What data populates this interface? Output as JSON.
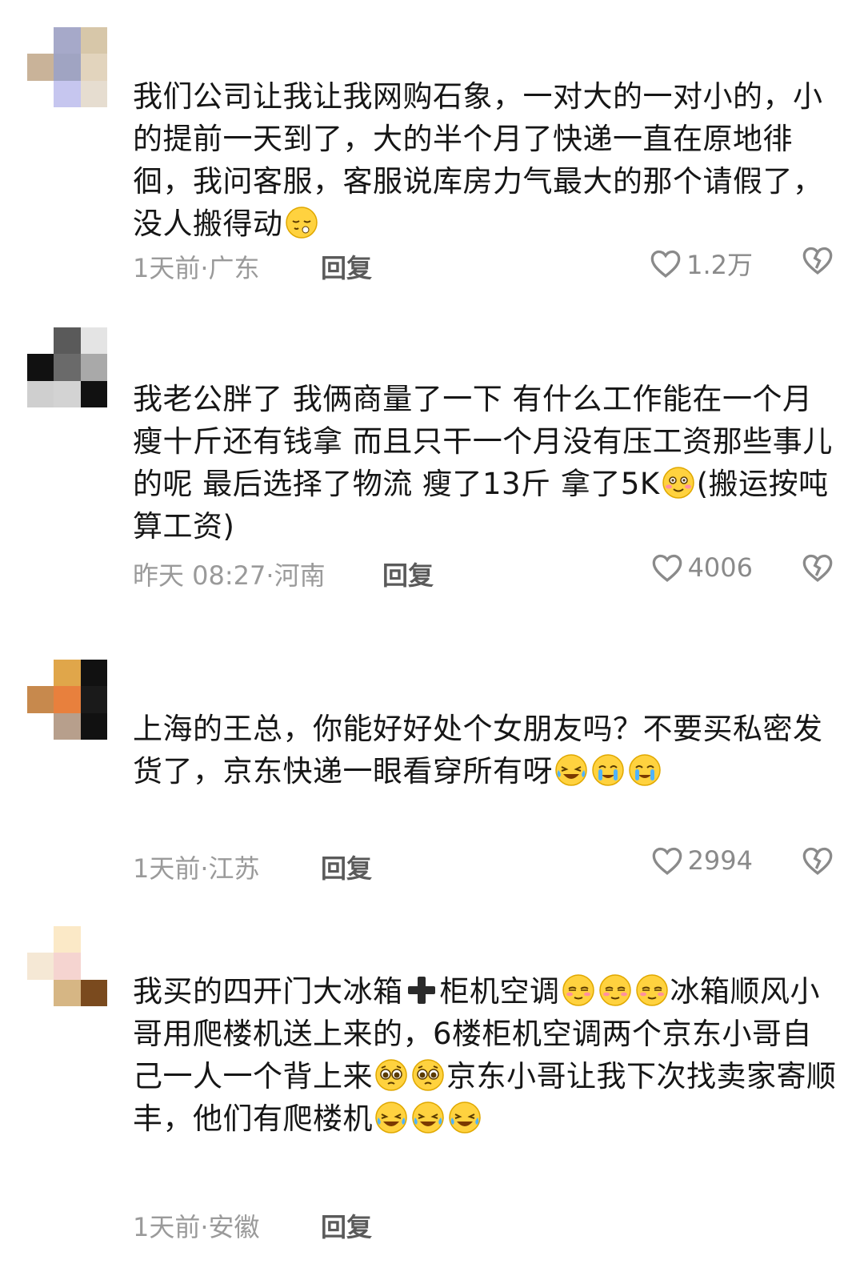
{
  "comments": [
    {
      "avatar_colors": [
        "#ffffff",
        "#a6a9c9",
        "#d7c7a9",
        "#c9b399",
        "#a0a4c2",
        "#e2d4bd",
        "#ffffff",
        "#c6c6ef",
        "#e6ddd0"
      ],
      "parts": [
        {
          "t": "我们公司让我让我网购石象，一对大的一对小的，小的提前一天到了，大的半个月了快递一直在原地徘徊，我问客服，客服说库房力气最大的那个请假了，没人搬得动"
        },
        {
          "e": "sleepy"
        }
      ],
      "time": "1天前·广东",
      "reply": "回复",
      "likes": "1.2万"
    },
    {
      "avatar_colors": [
        "#ffffff",
        "#5a5a5a",
        "#e4e4e4",
        "#111111",
        "#6a6a6a",
        "#a9a9a9",
        "#cfcfcf",
        "#d3d3d3",
        "#111111"
      ],
      "parts": [
        {
          "t": "我老公胖了 我俩商量了一下 有什么工作能在一个月瘦十斤还有钱拿 而且只干一个月没有压工资那些事儿的呢 最后选择了物流 瘦了13斤 拿了5K"
        },
        {
          "e": "shy"
        },
        {
          "t": "(搬运按吨算工资)"
        }
      ],
      "time": "昨天 08:27·河南",
      "reply": "回复",
      "likes": "4006"
    },
    {
      "avatar_colors": [
        "#ffffff",
        "#e0a64a",
        "#111111",
        "#c7894d",
        "#e8803d",
        "#1a1a1a",
        "#ffffff",
        "#b79f8c",
        "#111111"
      ],
      "parts": [
        {
          "t": "上海的王总，你能好好处个女朋友吗？不要买私密发货了，京东快递一眼看穿所有呀"
        },
        {
          "e": "cry-laugh"
        },
        {
          "e": "tears"
        },
        {
          "e": "tears"
        }
      ],
      "time": "1天前·江苏",
      "reply": "回复",
      "likes": "2994"
    },
    {
      "avatar_colors": [
        "#ffffff",
        "#fbe9c7",
        "#ffffff",
        "#f5e8d5",
        "#f5d4d0",
        "#ffffff",
        "#ffffff",
        "#d6b684",
        "#7a4a1e"
      ],
      "parts": [
        {
          "t": "我买的四开门大冰箱"
        },
        {
          "e": "plus"
        },
        {
          "t": "柜机空调"
        },
        {
          "e": "smug"
        },
        {
          "e": "smug"
        },
        {
          "e": "smug"
        },
        {
          "t": "冰箱顺风小哥用爬楼机送上来的，6楼柜机空调两个京东小哥自己一人一个背上来"
        },
        {
          "e": "pleading"
        },
        {
          "e": "pleading"
        },
        {
          "t": "京东小哥让我下次找卖家寄顺丰，他们有爬楼机"
        },
        {
          "e": "cry-laugh"
        },
        {
          "e": "cry-laugh"
        },
        {
          "e": "cry-laugh"
        }
      ],
      "time": "1天前·安徽",
      "reply": "回复",
      "likes": ""
    }
  ]
}
